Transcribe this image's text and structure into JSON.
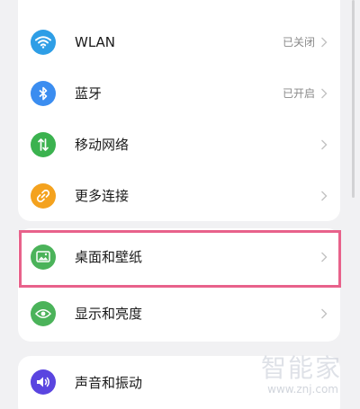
{
  "colors": {
    "wlan": "#2e9ee6",
    "bluetooth": "#3b8df0",
    "mobile_network": "#3bb24f",
    "more_connections": "#f4a21e",
    "wallpaper": "#4bb35a",
    "display": "#4bb35a",
    "sound": "#5a45e0",
    "highlight": "#e8628b"
  },
  "section1": {
    "items": [
      {
        "icon": "wifi-icon",
        "label": "WLAN",
        "value": "已关闭"
      },
      {
        "icon": "bluetooth-icon",
        "label": "蓝牙",
        "value": "已开启"
      },
      {
        "icon": "mobile-data-icon",
        "label": "移动网络",
        "value": ""
      },
      {
        "icon": "link-icon",
        "label": "更多连接",
        "value": ""
      }
    ]
  },
  "section2": {
    "items": [
      {
        "icon": "wallpaper-icon",
        "label": "桌面和壁纸",
        "value": ""
      },
      {
        "icon": "eye-icon",
        "label": "显示和亮度",
        "value": ""
      }
    ]
  },
  "section3": {
    "items": [
      {
        "icon": "speaker-icon",
        "label": "声音和振动",
        "value": ""
      }
    ]
  },
  "watermark": {
    "text": "智能家",
    "url": "www.znj.com"
  }
}
